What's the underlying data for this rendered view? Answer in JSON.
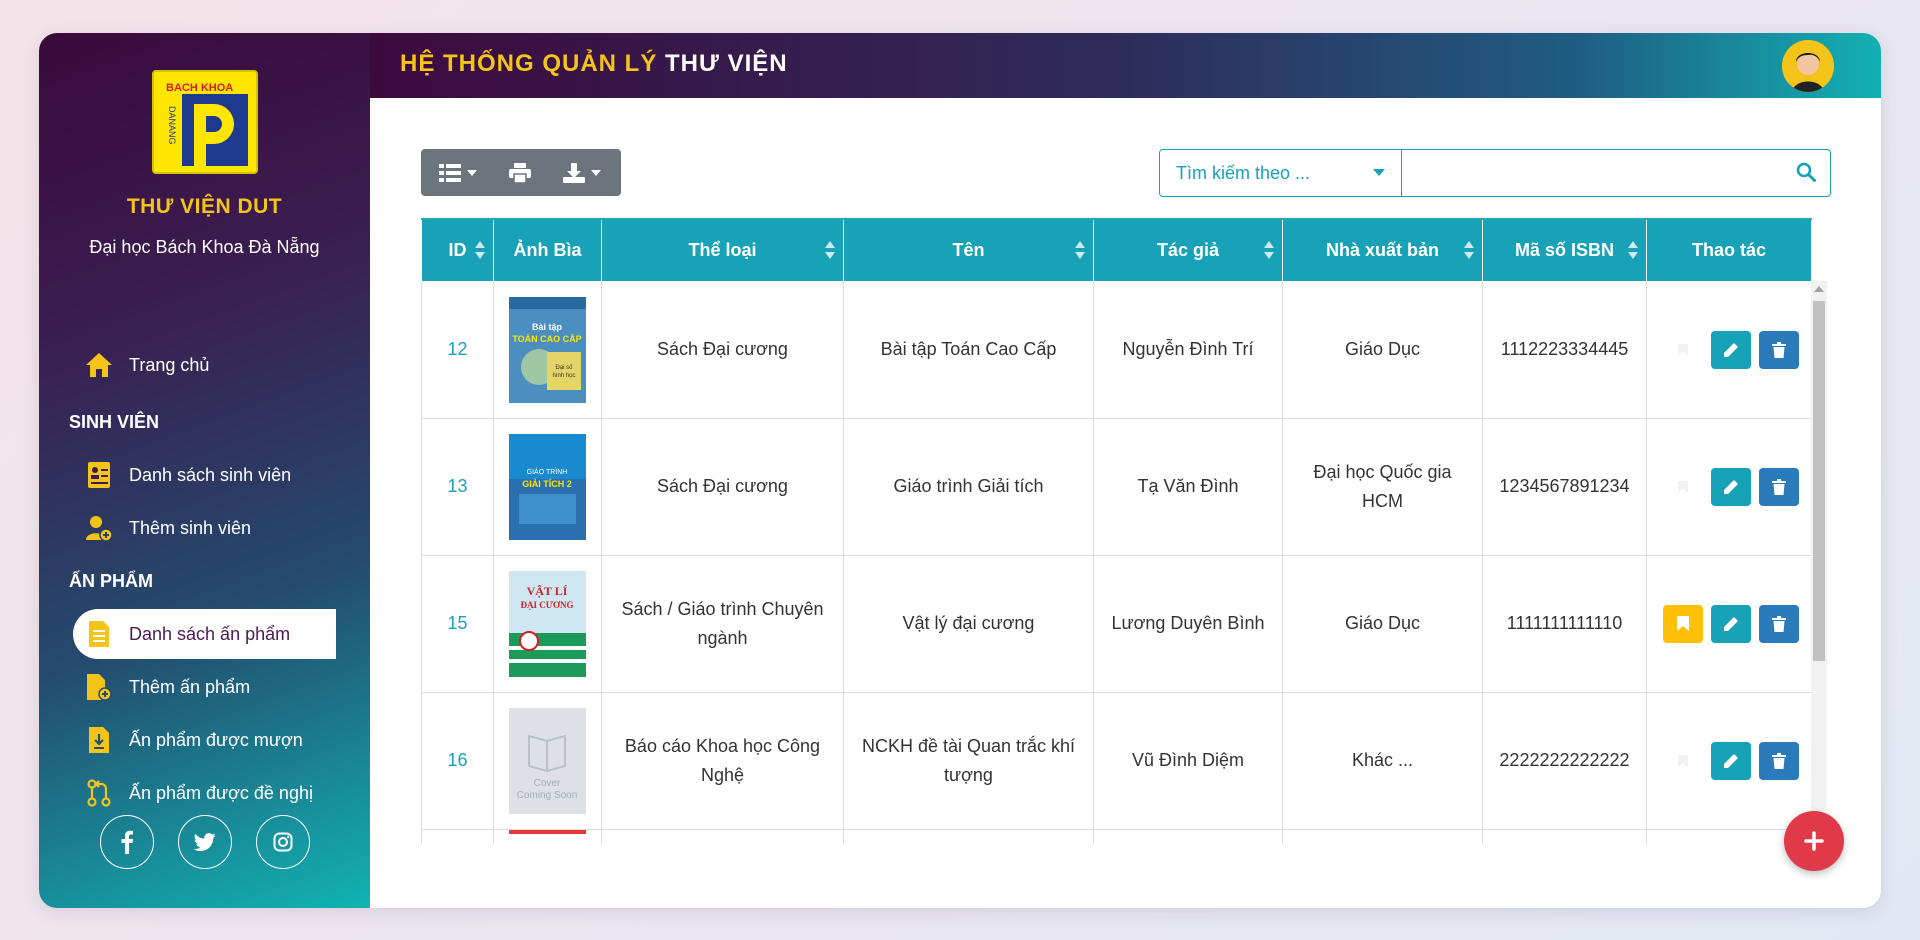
{
  "sidebar": {
    "logo_top_text": "BACH KHOA",
    "logo_side_text": "DANANG",
    "brand": "THƯ VIỆN DUT",
    "subbrand": "Đại học Bách Khoa Đà Nẵng",
    "home": "Trang chủ",
    "section_students": "SINH VIÊN",
    "student_list": "Danh sách sinh viên",
    "add_student": "Thêm sinh viên",
    "section_publications": "ẤN PHẨM",
    "publication_list": "Danh sách ấn phẩm",
    "add_publication": "Thêm ấn phẩm",
    "borrowed": "Ấn phẩm được mượn",
    "suggested": "Ấn phẩm được đề nghị"
  },
  "header": {
    "title_part1": "HỆ THỐNG QUẢN LÝ",
    "title_part2": "THƯ VIỆN"
  },
  "search": {
    "select_label": "Tìm kiếm theo ...",
    "input_value": ""
  },
  "table": {
    "headers": {
      "id": "ID",
      "cover": "Ảnh Bìa",
      "category": "Thể loại",
      "name": "Tên",
      "author": "Tác giả",
      "publisher": "Nhà xuất bản",
      "isbn": "Mã số ISBN",
      "actions": "Thao tác"
    },
    "rows": [
      {
        "id": "12",
        "category": "Sách Đại cương",
        "name": "Bài tập Toán Cao Cấp",
        "author": "Nguyễn Đình Trí",
        "publisher": "Giáo Dục",
        "isbn": "1112223334445",
        "cover_title": "Bài tập TOÁN CAO CẤP",
        "cover_sub": "Đại số và hình học giải tích"
      },
      {
        "id": "13",
        "category": "Sách Đại cương",
        "name": "Giáo trình Giải tích",
        "author": "Tạ Văn Đình",
        "publisher": "Đại học Quốc gia HCM",
        "isbn": "1234567891234",
        "cover_title": "GIÁO TRÌNH",
        "cover_sub": "GIẢI TÍCH 2"
      },
      {
        "id": "15",
        "category": "Sách / Giáo trình Chuyên ngành",
        "name": "Vật lý đại cương",
        "author": "Lương Duyên Bình",
        "publisher": "Giáo Dục",
        "isbn": "1111111111110",
        "cover_title": "VẬT LÍ",
        "cover_sub": "ĐẠI CƯƠNG"
      },
      {
        "id": "16",
        "category": "Báo cáo Khoa học Công Nghệ",
        "name": "NCKH đề tài Quan trắc khí tượng",
        "author": "Vũ Đình Diệm",
        "publisher": "Khác ...",
        "isbn": "2222222222222",
        "cover_title": "Cover",
        "cover_sub": "Coming Soon"
      }
    ]
  }
}
